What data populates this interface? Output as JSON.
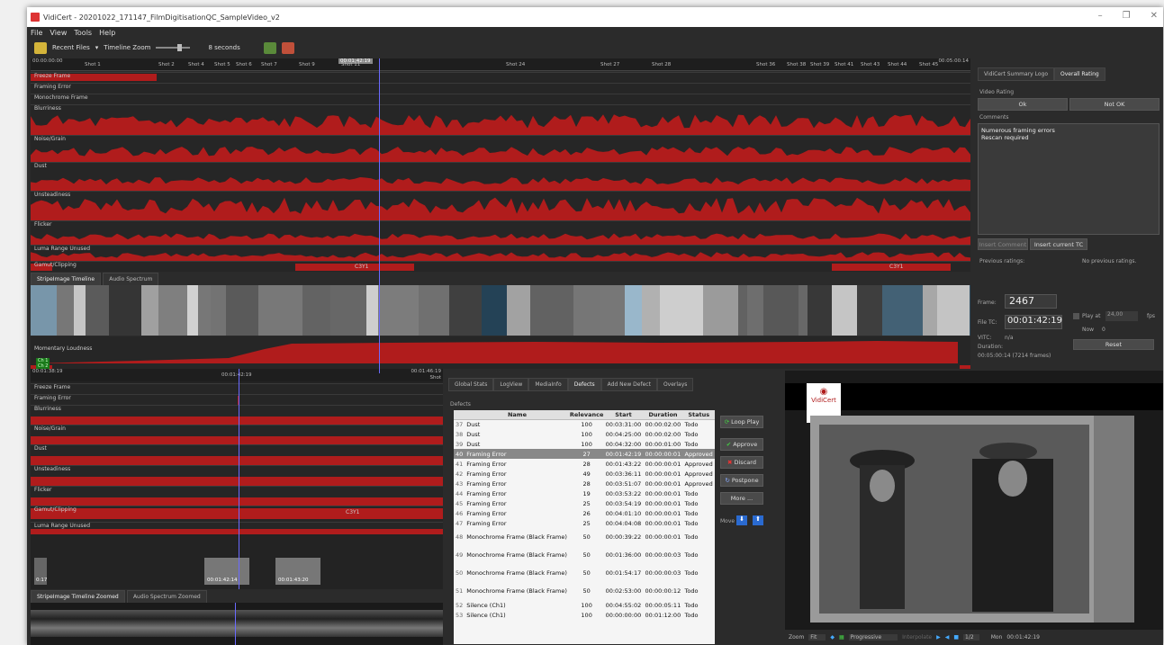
{
  "window": {
    "title": "VidiCert - 20201022_171147_FilmDigitisationQC_SampleVideo_v2"
  },
  "menu": [
    "File",
    "View",
    "Tools",
    "Help"
  ],
  "toolbar": {
    "recent_files": "Recent Files",
    "timeline_zoom": "Timeline Zoom",
    "zoom_value": "8 seconds"
  },
  "ruler": {
    "start_tc": "00:00:00:00",
    "end_tc": "00:05:00:14",
    "playhead_tc": "00:01:42:19",
    "shots": [
      "Shot 1",
      "Shot 2",
      "Shot 4",
      "Shot 5",
      "Shot 6",
      "Shot 7",
      "Shot 9",
      "Shot 11",
      "Shot 24",
      "Shot 27",
      "Shot 28",
      "Shot 36",
      "Shot 38",
      "Shot 39",
      "Shot 41",
      "Shot 43",
      "Shot 44",
      "Shot 45"
    ]
  },
  "tracks": [
    "Freeze Frame",
    "Framing Error",
    "Monochrome Frame",
    "Blurriness",
    "Noise/Grain",
    "Dust",
    "Unsteadiness",
    "Flicker",
    "Luma Range Unused",
    "Gamut/Clipping"
  ],
  "gamut_labels": [
    "C3Y1",
    "C3Y1",
    "C3Y1"
  ],
  "stripe_tabs": [
    "StripeImage Timeline",
    "Audio Spectrum"
  ],
  "loudness": {
    "label": "Momentary Loudness",
    "ch1": "Ch 1",
    "ch2": "Ch 2"
  },
  "right_panel": {
    "tabs": [
      "VidiCert Summary Logo",
      "Overall Rating"
    ],
    "video_rating": "Video Rating",
    "ok": "Ok",
    "not_ok": "Not OK",
    "comments_label": "Comments",
    "comments": [
      "Numerous framing errors",
      "Rescan required"
    ],
    "insert_comment": "Insert Comment",
    "insert_tc": "Insert current TC",
    "prev_ratings": "Previous ratings:",
    "no_prev": "No previous ratings.",
    "frame_label": "Frame:",
    "frame_value": "2467",
    "filetc_label": "File TC:",
    "filetc_value": "00:01:42:19",
    "vitc_label": "VITC:",
    "vitc_value": "n/a",
    "duration_label": "Duration:",
    "duration_value": "00:05:00:14 (7214 frames)",
    "play_at": "Play at",
    "fps_value": "24,00",
    "fps": "fps",
    "now": "Now",
    "now_value": "0",
    "reset": "Reset"
  },
  "zoomed": {
    "start_tc": "00:01:38:19",
    "mid_tc": "00:01:42:19",
    "end_tc": "00:01:46:19",
    "shot": "Shot",
    "tracks": [
      "Freeze Frame",
      "Framing Error",
      "Blurriness",
      "Noise/Grain",
      "Dust",
      "Unsteadiness",
      "Flicker",
      "Gamut/Clipping",
      "Luma Range Unused"
    ],
    "gamut_label": "C3Y1",
    "thumbs": [
      "0:17",
      "00:01:42:14",
      "00:01:43:20"
    ]
  },
  "bottom_tabs": [
    "StripeImage Timeline Zoomed",
    "Audio Spectrum Zoomed"
  ],
  "mid_tabs": [
    "Global Stats",
    "LogView",
    "MediaInfo",
    "Defects",
    "Add New Defect",
    "Overlays"
  ],
  "defects_label": "Defects",
  "table": {
    "headers": [
      "Name",
      "Relevance",
      "Start",
      "Duration",
      "Status"
    ],
    "rows": [
      [
        "37",
        "Dust",
        "100",
        "00:03:31:00",
        "00:00:02:00",
        "Todo"
      ],
      [
        "38",
        "Dust",
        "100",
        "00:04:25:00",
        "00:00:02:00",
        "Todo"
      ],
      [
        "39",
        "Dust",
        "100",
        "00:04:32:00",
        "00:00:01:00",
        "Todo"
      ],
      [
        "40",
        "Framing Error",
        "27",
        "00:01:42:19",
        "00:00:00:01",
        "Approved"
      ],
      [
        "41",
        "Framing Error",
        "28",
        "00:01:43:22",
        "00:00:00:01",
        "Approved"
      ],
      [
        "42",
        "Framing Error",
        "49",
        "00:03:36:11",
        "00:00:00:01",
        "Approved"
      ],
      [
        "43",
        "Framing Error",
        "28",
        "00:03:51:07",
        "00:00:00:01",
        "Approved"
      ],
      [
        "44",
        "Framing Error",
        "19",
        "00:03:53:22",
        "00:00:00:01",
        "Todo"
      ],
      [
        "45",
        "Framing Error",
        "25",
        "00:03:54:19",
        "00:00:00:01",
        "Todo"
      ],
      [
        "46",
        "Framing Error",
        "26",
        "00:04:01:10",
        "00:00:00:01",
        "Todo"
      ],
      [
        "47",
        "Framing Error",
        "25",
        "00:04:04:08",
        "00:00:00:01",
        "Todo"
      ],
      [
        "48",
        "Monochrome Frame (Black Frame)",
        "50",
        "00:00:39:22",
        "00:00:00:01",
        "Todo"
      ],
      [
        "49",
        "Monochrome Frame (Black Frame)",
        "50",
        "00:01:36:00",
        "00:00:00:03",
        "Todo"
      ],
      [
        "50",
        "Monochrome Frame (Black Frame)",
        "50",
        "00:01:54:17",
        "00:00:00:03",
        "Todo"
      ],
      [
        "51",
        "Monochrome Frame (Black Frame)",
        "50",
        "00:02:53:00",
        "00:00:00:12",
        "Todo"
      ],
      [
        "52",
        "Silence (Ch1)",
        "100",
        "00:04:55:02",
        "00:00:05:11",
        "Todo"
      ],
      [
        "53",
        "Silence (Ch1)",
        "100",
        "00:00:00:00",
        "00:01:12:00",
        "Todo"
      ]
    ]
  },
  "side_buttons": {
    "loop_play": "Loop Play",
    "approve": "Approve",
    "discard": "Discard",
    "postpone": "Postpone",
    "more": "More ...",
    "move": "Move"
  },
  "preview": {
    "logo": "VidiCert"
  },
  "bottom_bar": {
    "zoom": "Zoom",
    "fit": "Fit",
    "progressive": "Progressive",
    "interpolate": "Interpolate",
    "ratio": "1/2",
    "mon": "Mon",
    "mon_tc": "00:01:42:19"
  },
  "colors": {
    "accent_red": "#b01c1c",
    "playhead": "#6a6aff",
    "selected_row": "#888888"
  }
}
